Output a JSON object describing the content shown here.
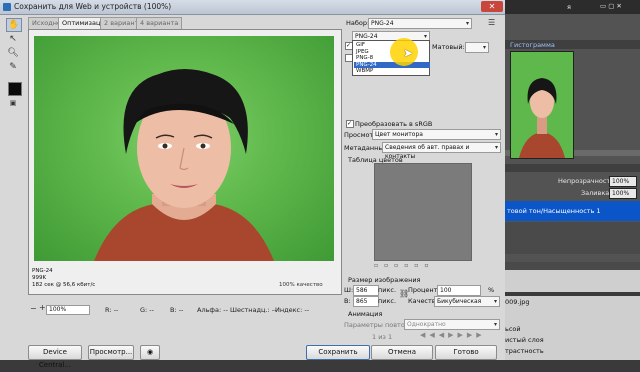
{
  "dialog": {
    "title": "Сохранить для Web и устройств (100%)",
    "tabs": [
      "Исходное",
      "Оптимизация",
      "2 варианта",
      "4 варианта"
    ],
    "active_tab": 1
  },
  "preview": {
    "info_lines": [
      "PNG-24",
      "999K",
      "182 сек @ 56,6 кбит/с"
    ],
    "info_tail": "100% качество"
  },
  "status": {
    "zoom": "100%",
    "r": "R: --",
    "g": "G: --",
    "b": "B: --",
    "alpha": "Альфа: --",
    "hex": "Шестнадц.: --",
    "index": "Индекс: --"
  },
  "buttons": {
    "device_central": "Device Central...",
    "preview": "Просмотр...",
    "save": "Сохранить",
    "cancel": "Отмена",
    "done": "Готово"
  },
  "settings": {
    "preset_label": "Набор:",
    "preset_value": "PNG-24",
    "format_value": "PNG-24",
    "format_options": [
      "GIF",
      "JPEG",
      "PNG-8",
      "PNG-24",
      "WBMP"
    ],
    "selected_format": 3,
    "matte_label": "Матовый:",
    "convert_srgb": "Преобразовать в sRGB",
    "preview_label": "Просмотр:",
    "preview_value": "Цвет монитора",
    "metadata_label": "Метаданные:",
    "metadata_value": "Сведения об авт. правах и контакты",
    "color_table_label": "Таблица цветов",
    "image_size_label": "Размер изображения",
    "width_label": "Ш:",
    "width_value": "586",
    "height_label": "В:",
    "height_value": "865",
    "unit": "пикс.",
    "percent_label": "Проценты:",
    "percent_value": "100",
    "percent_unit": "%",
    "quality_label": "Качество:",
    "quality_value": "Бикубическая",
    "animation_label": "Анимация",
    "loop_label": "Параметры повтора:",
    "loop_value": "Однократно",
    "frame_counter": "1 из 1"
  },
  "photoshop": {
    "panel_tab": "Гистограмма",
    "opacity_label": "Непрозрачность:",
    "opacity_value": "100%",
    "fill_label": "Заливка:",
    "fill_value": "100%",
    "layer_highlight": "товой тон/Насыщенность 1",
    "file_name": "009.jpg",
    "hist_1": "ьсой",
    "hist_2": "истый слоя",
    "hist_3": "трастность",
    "menu_ya": "я"
  }
}
